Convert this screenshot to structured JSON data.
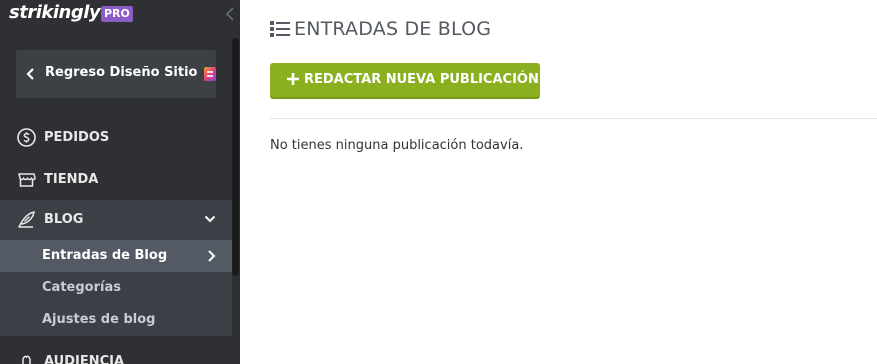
{
  "sidebar": {
    "brand": {
      "logo_text": "strikingly",
      "badge": "PRO"
    },
    "back_button": {
      "label": "Regreso Diseño Sitio"
    },
    "items": [
      {
        "label": "PEDIDOS",
        "icon": "dollar-circle-icon"
      },
      {
        "label": "TIENDA",
        "icon": "store-icon"
      },
      {
        "label": "BLOG",
        "icon": "quill-icon",
        "expanded": true
      },
      {
        "label": "AUDIENCIA",
        "icon": "audience-icon"
      }
    ],
    "blog_subitems": [
      {
        "label": "Entradas de Blog",
        "active": true
      },
      {
        "label": "Categorías"
      },
      {
        "label": "Ajustes de blog"
      }
    ]
  },
  "main": {
    "title": "ENTRADAS DE BLOG",
    "new_post_button": "REDACTAR NUEVA PUBLICACIÓN",
    "empty_message": "No tienes ninguna publicación todavía."
  },
  "colors": {
    "sidebar_bg": "#2e3033",
    "active_bg": "#545a63",
    "accent_green": "#8ab01f",
    "pro_purple": "#8a5cc4"
  }
}
